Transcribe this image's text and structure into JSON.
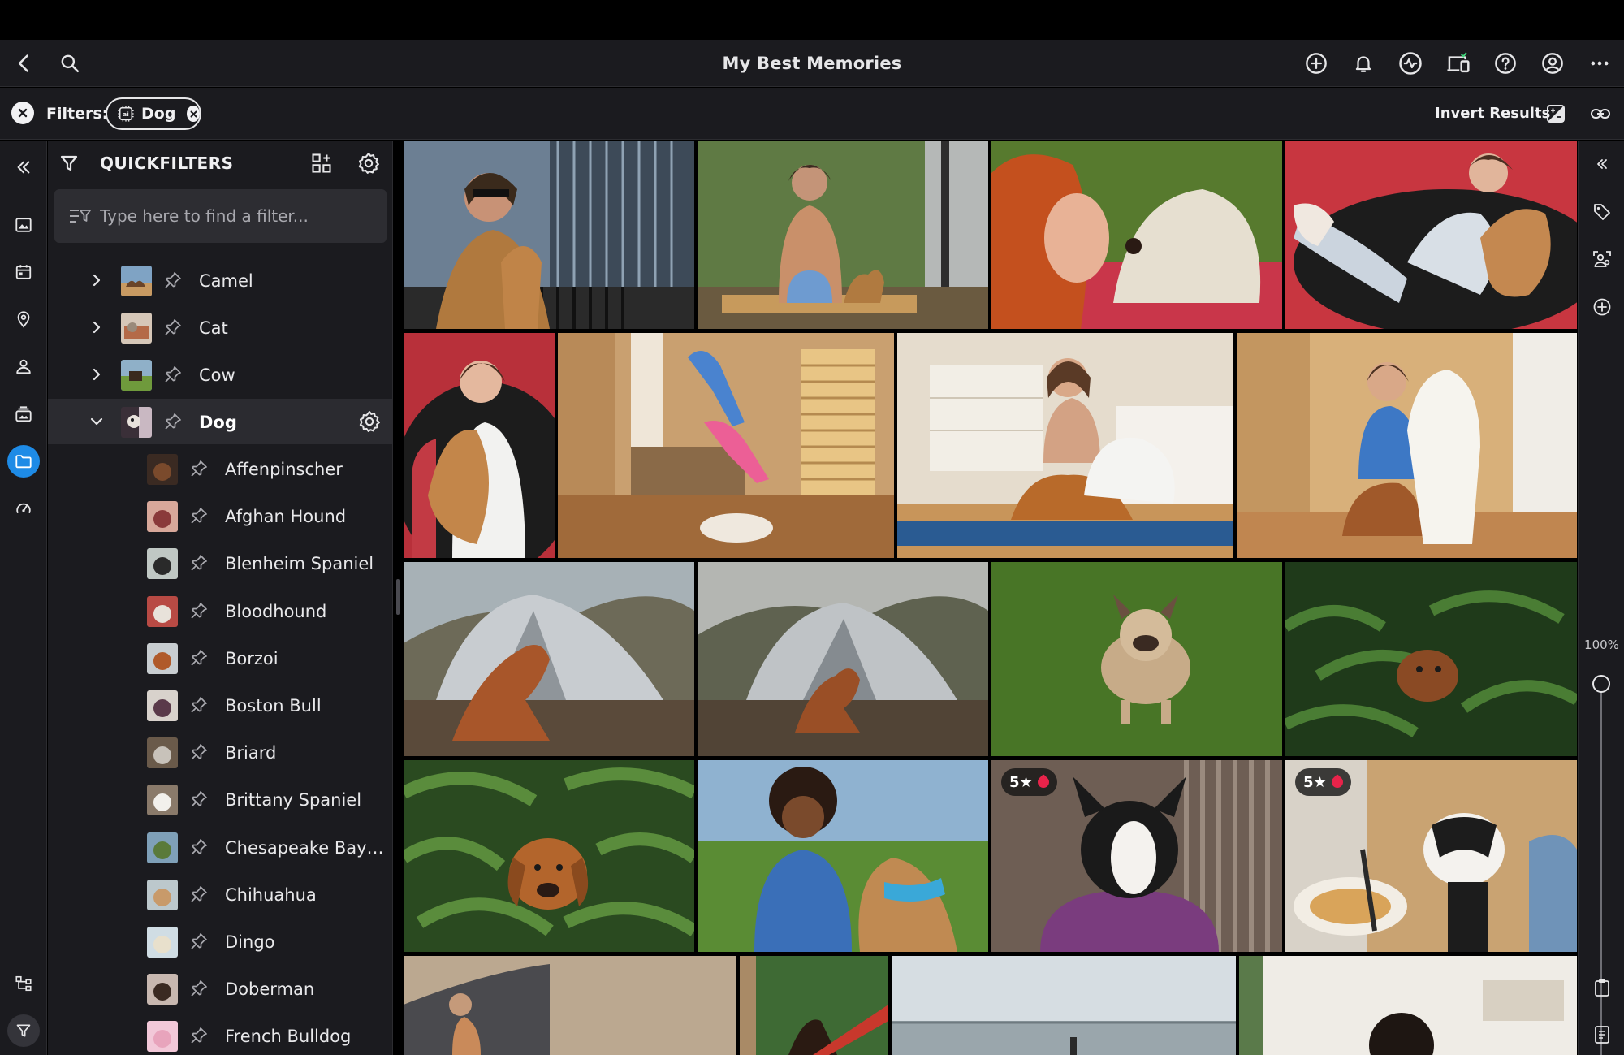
{
  "app": {
    "title": "My Best Memories"
  },
  "colors": {
    "background": "#1b1b1f",
    "accent": "#1e8be6",
    "rating_tag": "#e8234a"
  },
  "topbar_icons": [
    "back-icon",
    "search-icon",
    "add-circle-icon",
    "bell-icon",
    "activity-icon",
    "devices-icon",
    "help-icon",
    "account-icon",
    "more-icon"
  ],
  "filterbar": {
    "label": "Filters:",
    "chip": {
      "label": "Dog"
    },
    "invert_label": "Invert Results"
  },
  "panel": {
    "title": "QUICKFILTERS",
    "search_placeholder": "Type here to find a filter...",
    "items": [
      {
        "label": "Camel",
        "expanded": false
      },
      {
        "label": "Cat",
        "expanded": false
      },
      {
        "label": "Cow",
        "expanded": false
      },
      {
        "label": "Dog",
        "expanded": true,
        "selected": true
      }
    ],
    "dog_children": [
      "Affenpinscher",
      "Afghan Hound",
      "Blenheim Spaniel",
      "Bloodhound",
      "Borzoi",
      "Boston Bull",
      "Briard",
      "Brittany Spaniel",
      "Chesapeake Bay R...",
      "Chihuahua",
      "Dingo",
      "Doberman",
      "French Bulldog"
    ]
  },
  "grid": {
    "badges": [
      {
        "text": "5★"
      },
      {
        "text": "5★"
      }
    ]
  },
  "right_rail": {
    "zoom_label": "100%",
    "zoom_level_percent": 100
  }
}
